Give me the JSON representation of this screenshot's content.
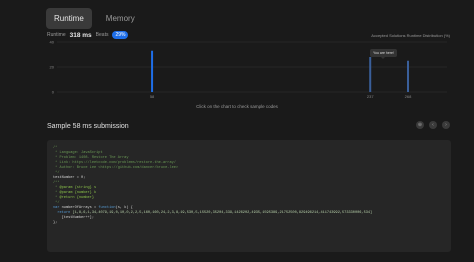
{
  "tabs": [
    {
      "label": "Runtime",
      "active": true
    },
    {
      "label": "Memory",
      "active": false
    }
  ],
  "stats": {
    "runtime_label": "Runtime",
    "runtime_value": "318 ms",
    "beats_label": "Beats",
    "beats_value": "29%",
    "distribution_label": "Accepted Solutions Runtime Distribution (%)"
  },
  "chart_data": {
    "type": "bar",
    "x": [
      58,
      237,
      268
    ],
    "values": [
      33,
      28,
      25
    ],
    "xticks": [
      "58",
      "237",
      "268"
    ],
    "yticks": [
      "40",
      "20",
      "0"
    ],
    "ylim": [
      0,
      40
    ],
    "xlim": [
      -20,
      300
    ],
    "accent_color": "#1e6ee8",
    "tooltip": "You are here!"
  },
  "hint": "Click on the chart to check sample codes",
  "sample": {
    "title": "Sample 58 ms submission"
  },
  "icons": [
    "expand-icon",
    "prev-icon",
    "next-icon"
  ],
  "code_lines": [
    [
      {
        "c": "c-comment",
        "t": "/*"
      }
    ],
    [
      {
        "c": "c-comment",
        "t": " * Language: JavaScript"
      }
    ],
    [
      {
        "c": "c-comment",
        "t": " * Problem: 1408. Restore The Array"
      }
    ],
    [
      {
        "c": "c-comment",
        "t": " * Link: https://leetcode.com/problems/restore-the-array/"
      }
    ],
    [
      {
        "c": "c-comment",
        "t": " * Author: Bruce Lee <https://github.com/dancer/bruce-lee>"
      }
    ],
    [
      {
        "c": "c-comment",
        "t": " */"
      }
    ],
    [
      {
        "c": "c-plain",
        "t": "testNumber = 0;"
      }
    ],
    [
      {
        "c": "c-comment",
        "t": "/**"
      }
    ],
    [
      {
        "c": "c-comment",
        "t": " * "
      },
      {
        "c": "c-tag",
        "t": "@param {string} s"
      }
    ],
    [
      {
        "c": "c-comment",
        "t": " * "
      },
      {
        "c": "c-tag",
        "t": "@param {number} k"
      }
    ],
    [
      {
        "c": "c-comment",
        "t": " * "
      },
      {
        "c": "c-tag",
        "t": "@return {number}"
      }
    ],
    [
      {
        "c": "c-comment",
        "t": " */"
      }
    ],
    [
      {
        "c": "c-keyword",
        "t": "var "
      },
      {
        "c": "c-plain",
        "t": "numberOfArrays = "
      },
      {
        "c": "c-keyword",
        "t": "function"
      },
      {
        "c": "c-plain",
        "t": "(s, k) {"
      }
    ],
    [
      {
        "c": "c-plain",
        "t": "  "
      },
      {
        "c": "c-keyword",
        "t": "return "
      },
      {
        "c": "c-num",
        "t": "[1,8,6,1,34,4079,19,0,10,0,2,2,5,160,160,24,2,3,8,19,530,5,15520,35204,339,1426202,4935,1595389,21752500,829496214,411743992,573330006,534]"
      }
    ],
    [
      {
        "c": "c-plain",
        "t": "    [testNumber++];"
      }
    ],
    [
      {
        "c": "c-plain",
        "t": "};"
      }
    ]
  ]
}
